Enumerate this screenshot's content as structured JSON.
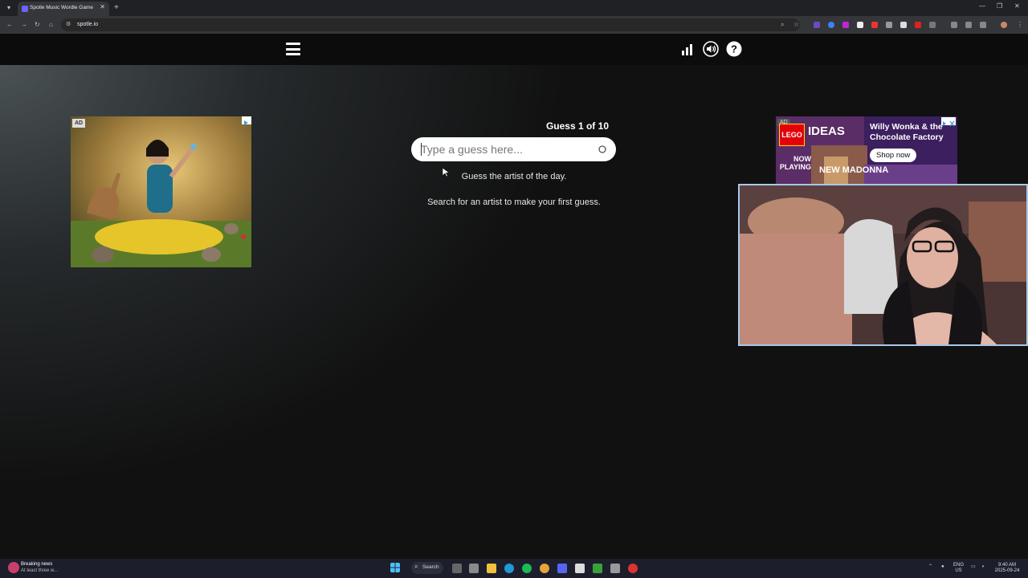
{
  "browser": {
    "tab_title": "Spotle Music Wordle Game",
    "url": "spotle.io",
    "new_tab": "+",
    "close_tab": "✕",
    "win_min": "—",
    "win_max": "❐",
    "win_close": "✕"
  },
  "game": {
    "guess_counter": "Guess 1 of 10",
    "input_placeholder": "Type a guess here...",
    "tagline": "Guess the artist of the day.",
    "hint": "Search for an artist to make your first guess."
  },
  "ads": {
    "left_badge": "AD",
    "right_badge": "AD",
    "right": {
      "logo": "LEGO",
      "brand": "IDEAS",
      "product": "Willy Wonka & the Chocolate Factory",
      "cta": "Shop now",
      "now_playing": "NOW PLAYING",
      "subtitle": "NEW MADONNA"
    }
  },
  "taskbar": {
    "news_title": "Breaking news",
    "news_sub": "At least three w...",
    "search_label": "Search",
    "lang": "ENG",
    "region": "US",
    "time": "9:40 AM",
    "date": "2025-09-24"
  },
  "colors": {
    "accent_purple": "#6c63ff",
    "webcam_border": "#a8c8e8",
    "lego_red": "#e3000b"
  }
}
